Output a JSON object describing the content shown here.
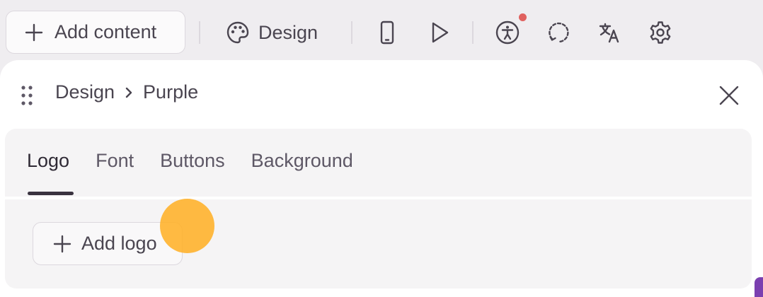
{
  "toolbar": {
    "add_content_label": "Add content",
    "design_label": "Design",
    "icons": [
      "plus-icon",
      "palette-icon",
      "mobile-preview-icon",
      "play-icon",
      "accessibility-icon",
      "history-icon",
      "translate-icon",
      "settings-icon"
    ],
    "notification_color": "#e0615f"
  },
  "panel": {
    "breadcrumb": {
      "parent": "Design",
      "current": "Purple"
    },
    "tabs": [
      {
        "label": "Logo",
        "active": true
      },
      {
        "label": "Font",
        "active": false
      },
      {
        "label": "Buttons",
        "active": false
      },
      {
        "label": "Background",
        "active": false
      }
    ],
    "add_logo_label": "Add logo"
  },
  "colors": {
    "cursor_highlight": "#ffb028",
    "accent": "#7b3fb0"
  }
}
